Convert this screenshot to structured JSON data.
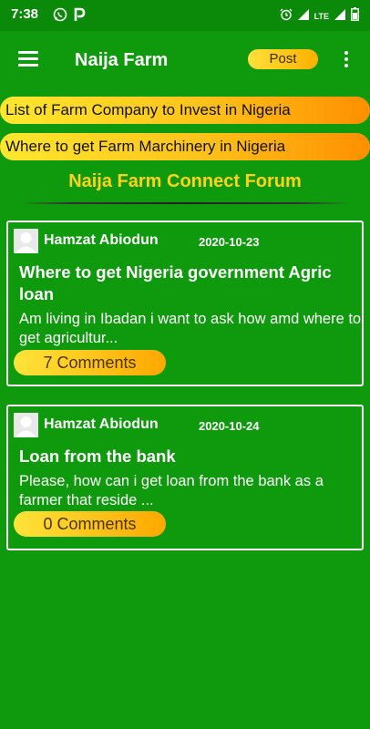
{
  "status_bar": {
    "time": "7:38",
    "left_icons": [
      "whatsapp-icon",
      "p-app-icon"
    ],
    "right_icons": [
      "alarm-icon",
      "signal-icon",
      "lte-icon",
      "signal-icon",
      "battery-icon"
    ],
    "lte_label": "LTE"
  },
  "app_bar": {
    "title": "Naija Farm",
    "post_label": "Post",
    "background": "#0f990c",
    "accent": "#ffc21a"
  },
  "banners": [
    {
      "label": "List of Farm Company to Invest in Nigeria"
    },
    {
      "label": "Where to get Farm Marchinery in Nigeria"
    }
  ],
  "forum": {
    "title": "Naija Farm Connect Forum",
    "posts": [
      {
        "author": "Hamzat Abiodun",
        "date": "2020-10-23",
        "title": "Where to get Nigeria government Agric loan",
        "excerpt": "Am living in Ibadan i want to ask how amd where to get agricultur...",
        "comments_label": "7 Comments"
      },
      {
        "author": "Hamzat Abiodun",
        "date": "2020-10-24",
        "title": "Loan from the bank",
        "excerpt": "Please, how can i get loan from the bank as a farmer that reside ...",
        "comments_label": "0 Comments"
      }
    ]
  }
}
